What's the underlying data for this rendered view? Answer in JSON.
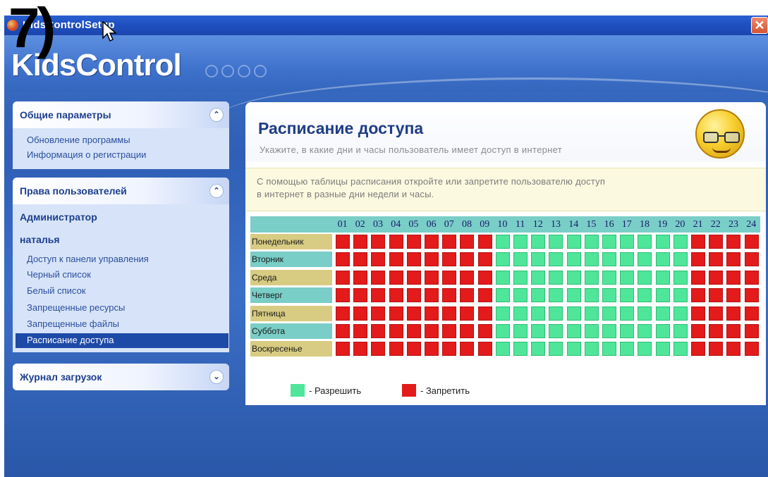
{
  "slide_number": "7)",
  "window": {
    "title": "KidsControlSetup",
    "logo": "KidsControl",
    "close_glyph": "✕"
  },
  "sidebar": {
    "general": {
      "title": "Общие параметры",
      "items": [
        "Обновление программы",
        "Информация о регистрации"
      ]
    },
    "rights": {
      "title": "Права пользователей",
      "users": [
        "Администратор",
        "наталья"
      ],
      "items": [
        "Доступ к панели управления",
        "Черный список",
        "Белый список",
        "Запрещенные ресурсы",
        "Запрещенные файлы",
        "Расписание доступа"
      ],
      "selected": "Расписание доступа"
    },
    "log": {
      "title": "Журнал загрузок"
    }
  },
  "content": {
    "title": "Расписание доступа",
    "subtitle": "Укажите, в какие дни и часы пользователь имеет доступ в интернет",
    "info_line1": "С помощью таблицы расписания откройте или запретите пользователю доступ",
    "info_line2": "в интернет в разные дни недели и часы."
  },
  "schedule": {
    "hours": [
      "01",
      "02",
      "03",
      "04",
      "05",
      "06",
      "07",
      "08",
      "09",
      "10",
      "11",
      "12",
      "13",
      "14",
      "15",
      "16",
      "17",
      "18",
      "19",
      "20",
      "21",
      "22",
      "23",
      "24"
    ],
    "days": [
      "Понедельник",
      "Вторник",
      "Среда",
      "Четверг",
      "Пятница",
      "Суббота",
      "Воскресенье"
    ],
    "day_colors": [
      "#d8cc82",
      "#79cec7",
      "#d8cc82",
      "#79cec7",
      "#d8cc82",
      "#79cec7",
      "#d8cc82"
    ],
    "rows": [
      "DDDDDDDDDAAAAAAAAAAADDDD",
      "DDDDDDDDDAAAAAAAAAAADDDD",
      "DDDDDDDDDAAAAAAAAAAADDDD",
      "DDDDDDDDDAAAAAAAAAAADDDD",
      "DDDDDDDDDAAAAAAAAAAADDDD",
      "DDDDDDDDDAAAAAAAAAAADDDD",
      "DDDDDDDDDAAAAAAAAAAADDDD"
    ]
  },
  "legend": {
    "allow": "- Разрешить",
    "deny": "- Запретить",
    "allow_color": "#4fe69a",
    "deny_color": "#e31b1b"
  },
  "icons": [
    "app-icon",
    "close-icon",
    "chevron-up-icon",
    "chevron-down-icon",
    "glasses-smiley-icon",
    "mouse-cursor-icon"
  ]
}
